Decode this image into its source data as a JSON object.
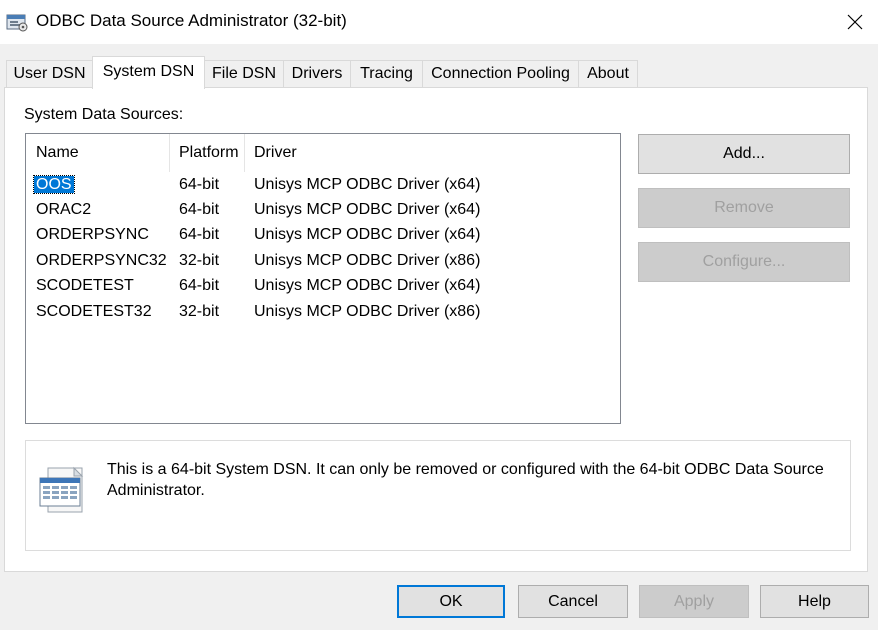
{
  "window": {
    "title": "ODBC Data Source Administrator (32-bit)",
    "icon": "odbc-admin-icon",
    "close_icon": "close-icon"
  },
  "tabs": [
    {
      "label": "User DSN"
    },
    {
      "label": "System DSN",
      "active": true
    },
    {
      "label": "File DSN"
    },
    {
      "label": "Drivers"
    },
    {
      "label": "Tracing"
    },
    {
      "label": "Connection Pooling"
    },
    {
      "label": "About"
    }
  ],
  "system_dsn": {
    "group_label": "System Data Sources:",
    "columns": [
      "Name",
      "Platform",
      "Driver"
    ],
    "rows": [
      {
        "name": "OOS",
        "platform": "64-bit",
        "driver": "Unisys MCP ODBC Driver (x64)",
        "selected": true
      },
      {
        "name": "ORAC2",
        "platform": "64-bit",
        "driver": "Unisys MCP ODBC Driver (x64)"
      },
      {
        "name": "ORDERPSYNC",
        "platform": "64-bit",
        "driver": "Unisys MCP ODBC Driver (x64)"
      },
      {
        "name": "ORDERPSYNC32",
        "platform": "32-bit",
        "driver": "Unisys MCP ODBC Driver (x86)"
      },
      {
        "name": "SCODETEST",
        "platform": "64-bit",
        "driver": "Unisys MCP ODBC Driver (x64)"
      },
      {
        "name": "SCODETEST32",
        "platform": "32-bit",
        "driver": "Unisys MCP ODBC Driver (x86)"
      }
    ],
    "buttons": {
      "add": "Add...",
      "remove": "Remove",
      "configure": "Configure..."
    },
    "info_text": "This is a 64-bit System DSN. It can only be removed or configured with the 64-bit ODBC Data Source Administrator.",
    "info_icon": "data-source-icon"
  },
  "footer": {
    "ok": "OK",
    "cancel": "Cancel",
    "apply": "Apply",
    "help": "Help"
  },
  "colors": {
    "selection": "#0078d7",
    "default_button_border": "#0078d7",
    "disabled_text": "#a0a0a0"
  }
}
